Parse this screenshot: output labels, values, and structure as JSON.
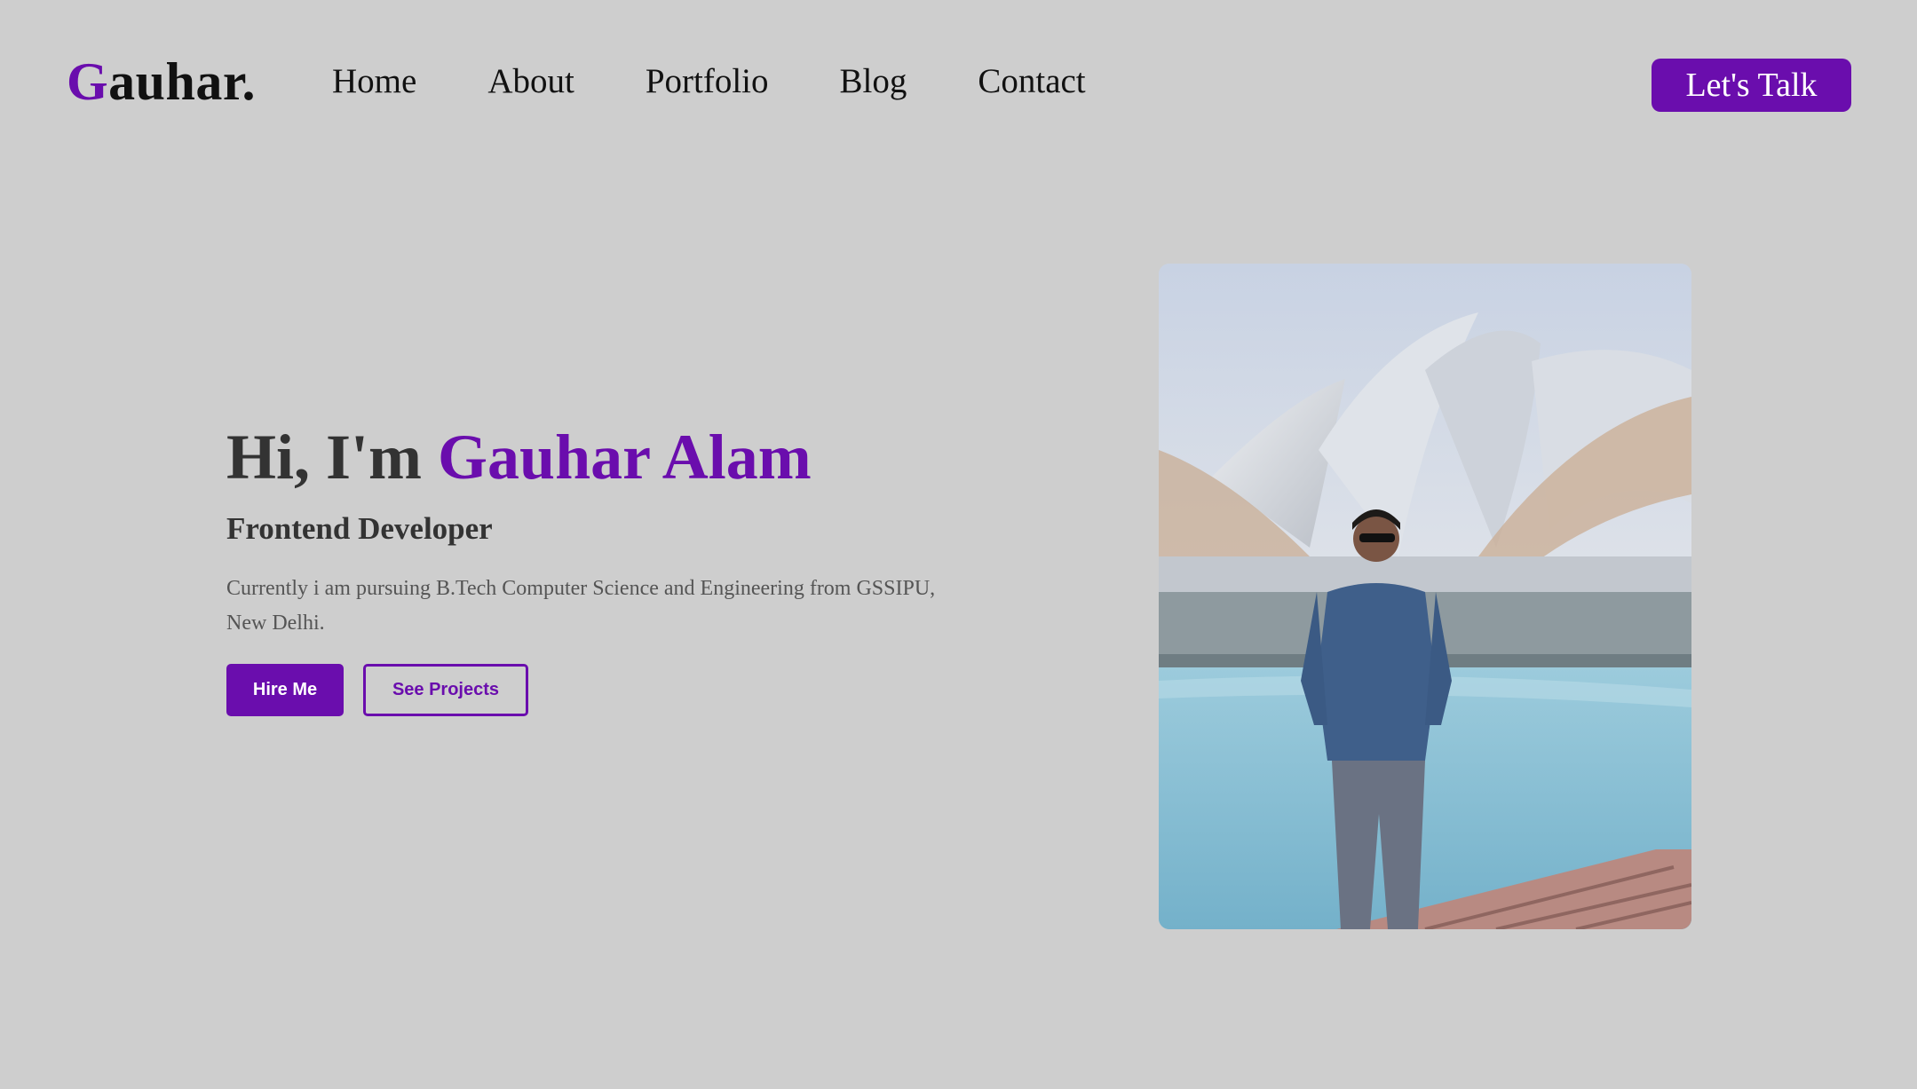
{
  "header": {
    "logo": {
      "initial": "G",
      "rest": "auhar."
    },
    "nav": [
      "Home",
      "About",
      "Portfolio",
      "Blog",
      "Contact"
    ],
    "cta_label": "Let's Talk"
  },
  "hero": {
    "greeting": "Hi, I'm ",
    "name": "Gauhar Alam",
    "role": "Frontend Developer",
    "description": "Currently i am pursuing B.Tech Computer Science and Engineering from GSSIPU, New Delhi.",
    "primary_button": "Hire Me",
    "secondary_button": "See Projects"
  },
  "colors": {
    "accent": "#6a0dad",
    "background": "#cecece",
    "heading": "#333333",
    "body_text": "#555555"
  }
}
